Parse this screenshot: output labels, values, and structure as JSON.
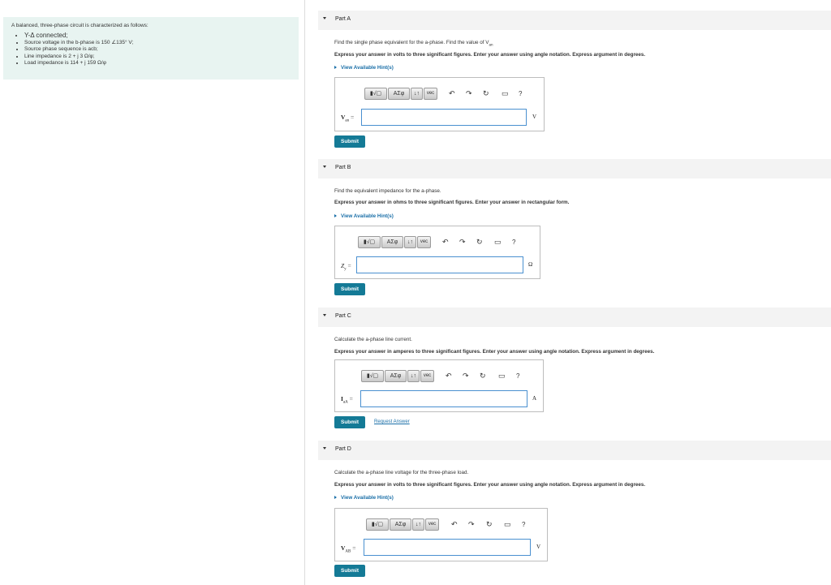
{
  "problem": {
    "intro": "A balanced, three-phase circuit is characterized as follows:",
    "items": [
      "Y-Δ connected;",
      "Source voltage in the b-phase is 150 ∠135° V;",
      "Source phase sequence is acb;",
      "Line impedance is 2 + j 3 Ω/φ;",
      "Load impedance is 114 + j 159 Ω/φ"
    ]
  },
  "toolbar": {
    "templates": "▮√▢",
    "greek": "ΑΣφ",
    "arrows": "↓↑",
    "vec": "vec",
    "undo": "↶",
    "redo": "↷",
    "reset": "↻",
    "keyboard": "▭",
    "help": "?"
  },
  "parts": [
    {
      "label": "Part A",
      "question": "Find the single phase equivalent for the a-phase. Find the value of V",
      "question_sub": "an",
      "instruction": "Express your answer in volts to three significant figures. Enter your answer using angle notation. Express argument in degrees.",
      "hint": "View Available Hint(s)",
      "var": "V",
      "var_sub": "an",
      "unit": "V",
      "submit": "Submit"
    },
    {
      "label": "Part B",
      "question": "Find the equivalent impedance for the a-phase.",
      "instruction": "Express your answer in ohms to three significant figures. Enter your answer in rectangular form.",
      "hint": "View Available Hint(s)",
      "var": "Z",
      "var_sub": "y",
      "unit": "Ω",
      "submit": "Submit"
    },
    {
      "label": "Part C",
      "question": "Calculate the a-phase line current.",
      "instruction": "Express your answer in amperes to three significant figures. Enter your answer using angle notation. Express argument in degrees.",
      "var": "I",
      "var_sub": "aA",
      "unit": "A",
      "submit": "Submit",
      "request": "Request Answer"
    },
    {
      "label": "Part D",
      "question": "Calculate the a-phase line voltage for the three-phase load.",
      "instruction": "Express your answer in volts to three significant figures. Enter your answer using angle notation. Express argument in degrees.",
      "hint": "View Available Hint(s)",
      "var": "V",
      "var_sub": "AB",
      "unit": "V",
      "submit": "Submit"
    }
  ]
}
